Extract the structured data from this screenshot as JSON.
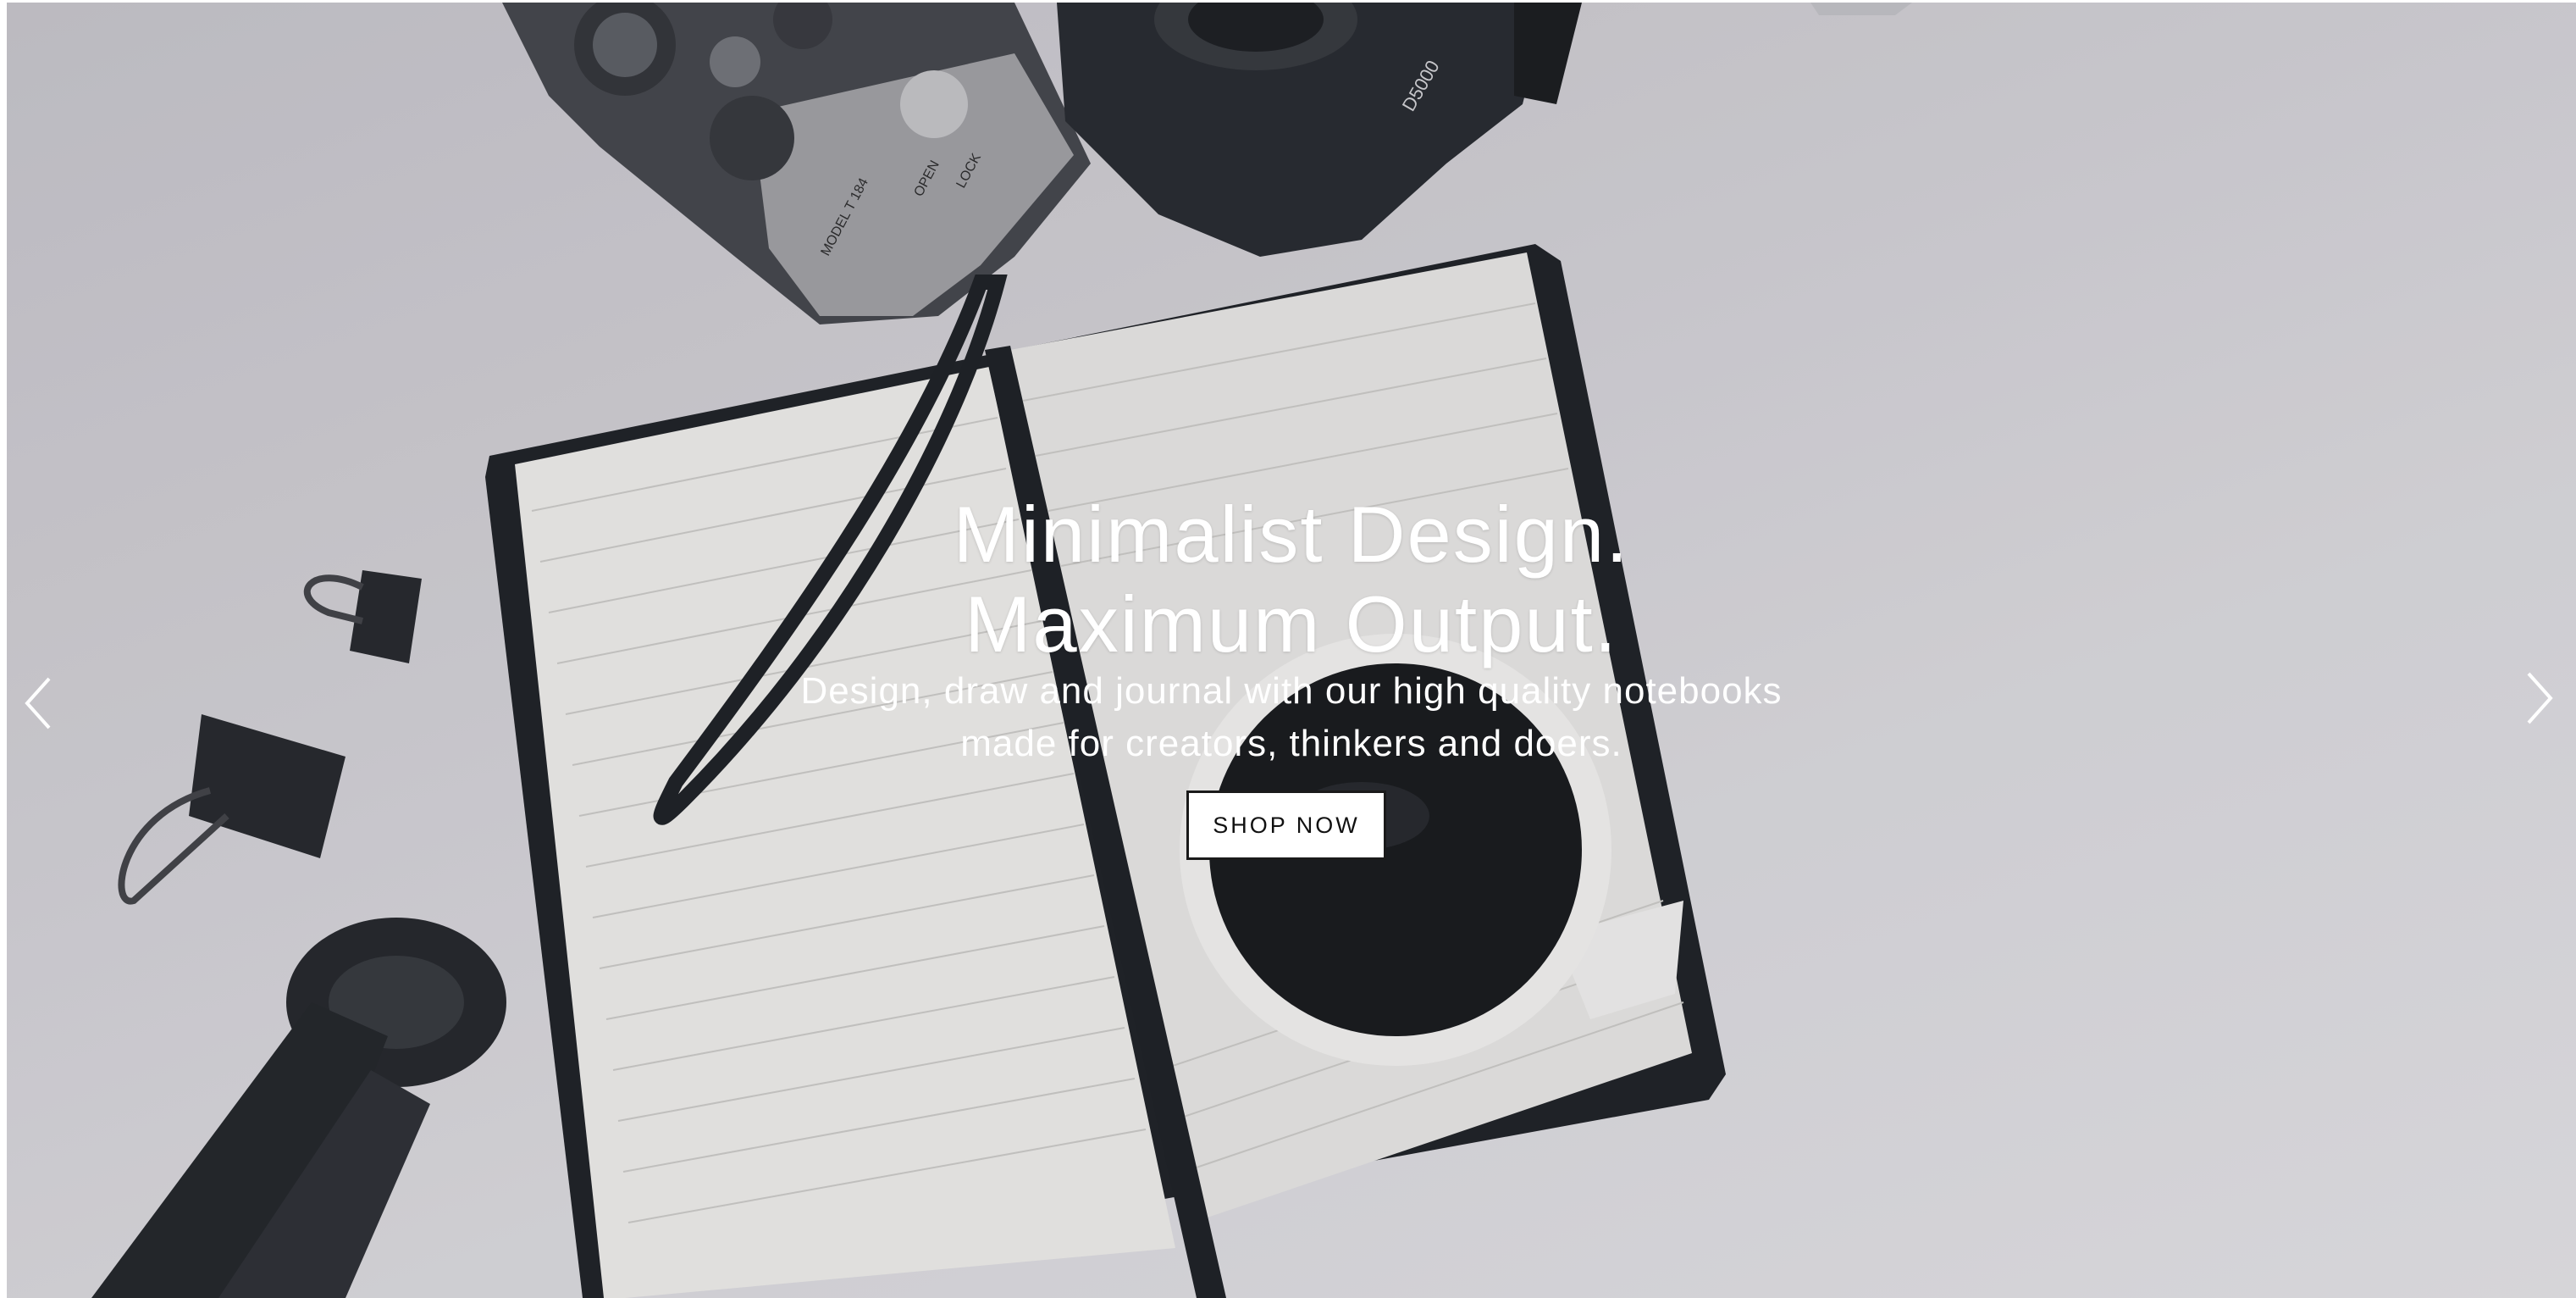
{
  "hero": {
    "headline_line1": "Minimalist Design.",
    "headline_line2": "Maximum Output.",
    "subtext_line1": "Design, draw and journal with our high quality notebooks",
    "subtext_line2": "made for creators, thinkers and doers.",
    "cta_label": "SHOP NOW"
  },
  "carousel": {
    "prev_icon": "chevron-left-icon",
    "next_icon": "chevron-right-icon"
  },
  "product_photo": {
    "camera_labels": [
      "MODEL T 184",
      "OPEN",
      "LOCK",
      "D5000"
    ]
  },
  "colors": {
    "background": "#d4d3d7",
    "text": "#ffffff",
    "button_bg": "#ffffff",
    "button_text": "#111111",
    "dark_objects": "#1e2126"
  }
}
